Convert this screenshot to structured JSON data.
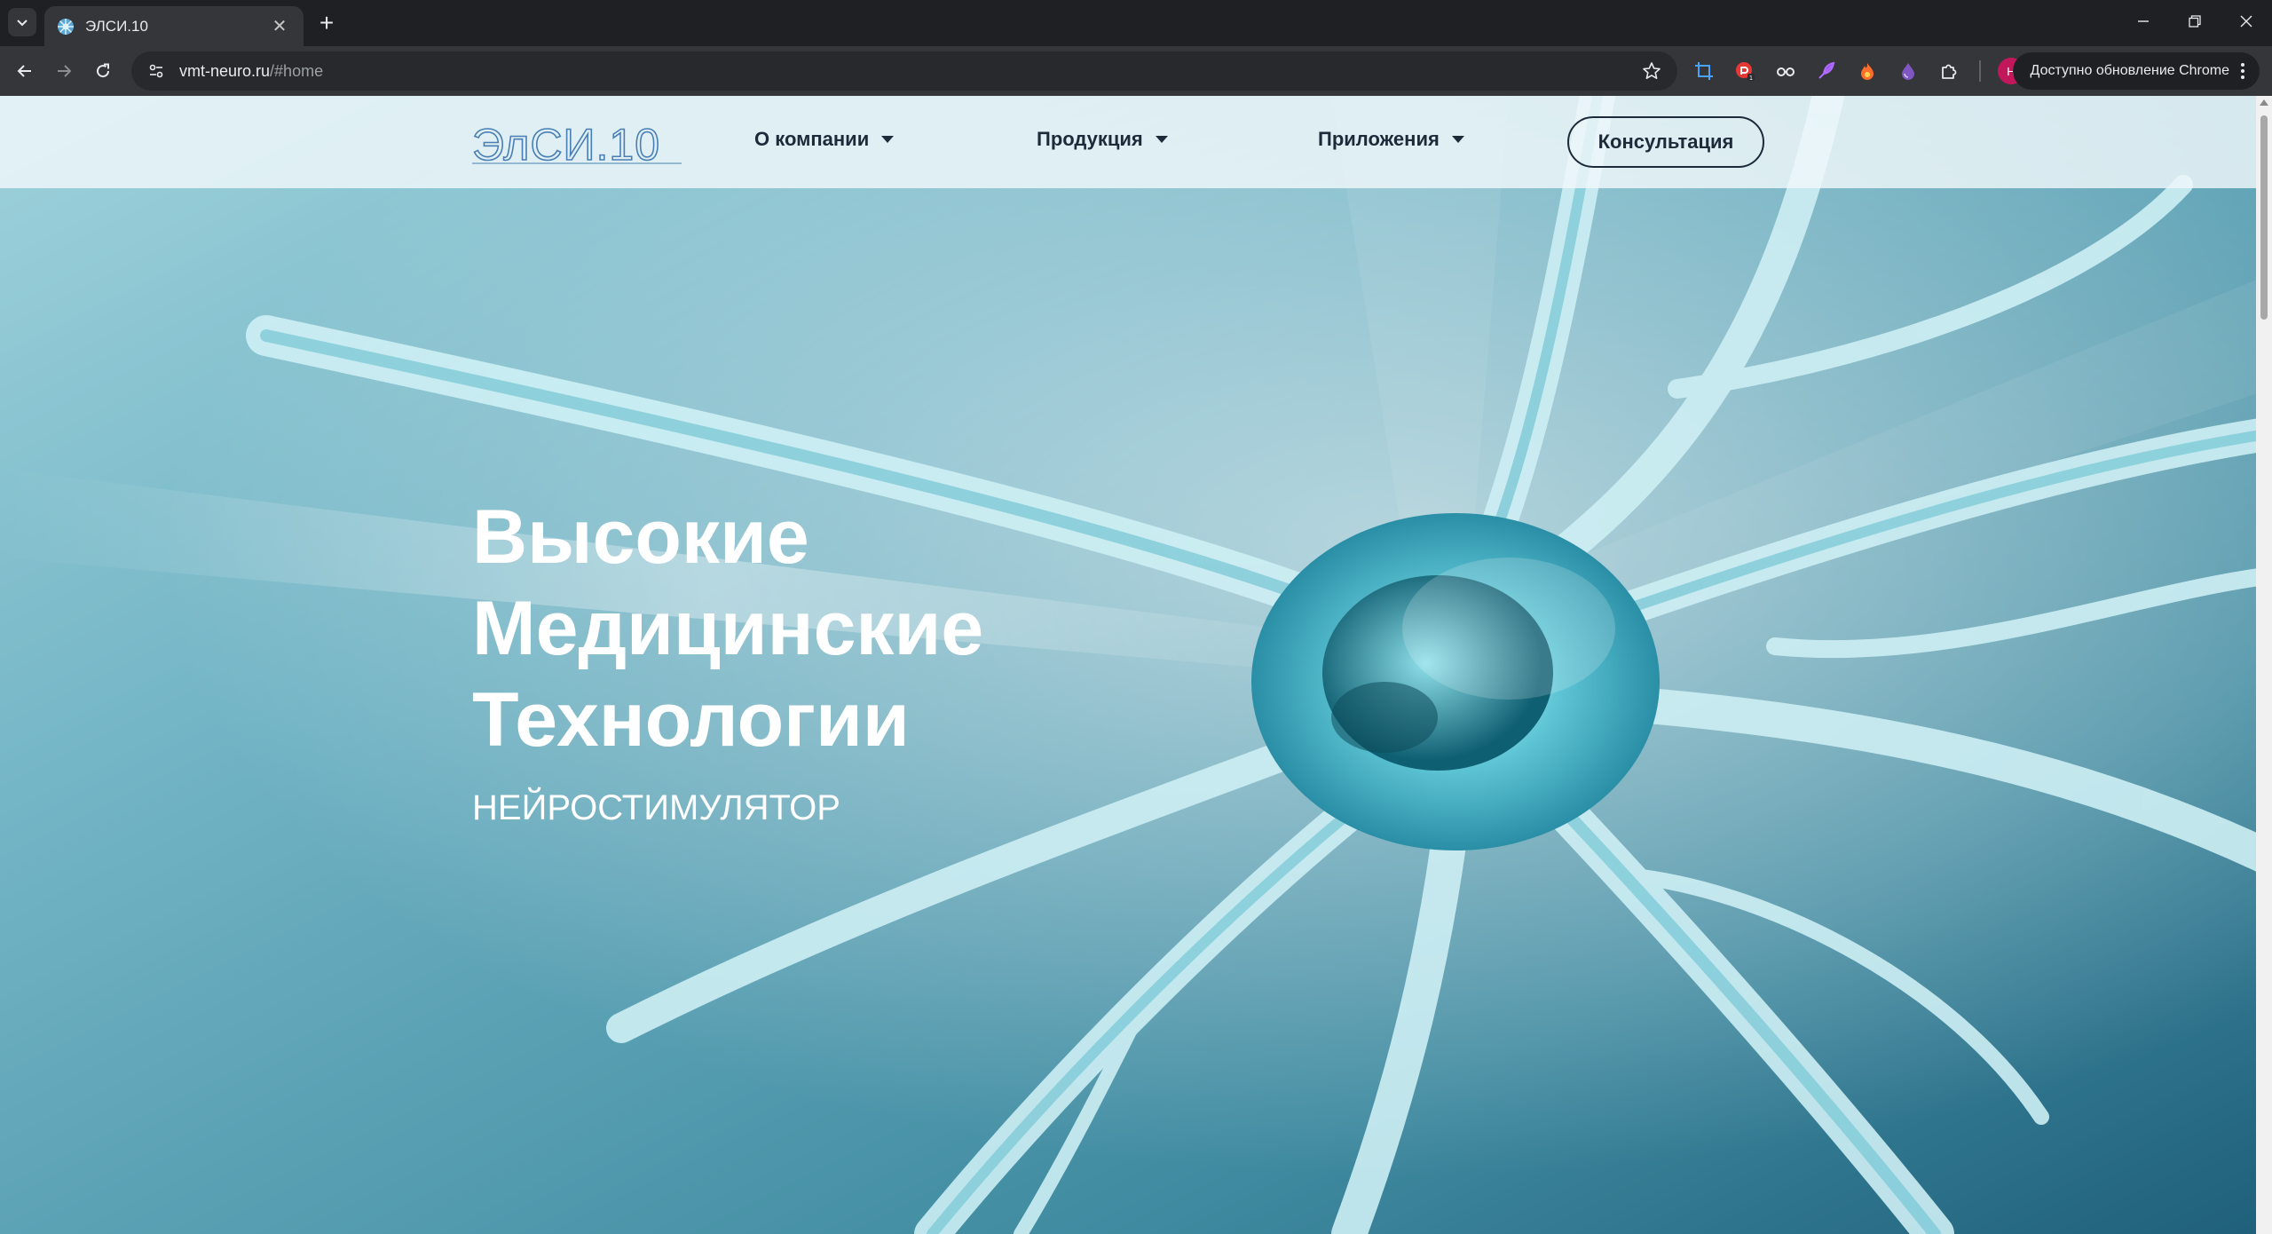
{
  "browser": {
    "tab_title": "ЭЛСИ.10",
    "url_host": "vmt-neuro.ru",
    "url_path": "/#home",
    "profile_initial": "Н",
    "update_label": "Доступно обновление Chrome"
  },
  "site": {
    "logo_text": "ЭлСИ.10",
    "nav": {
      "about": "О компании",
      "products": "Продукция",
      "apps": "Приложения",
      "consult": "Консультация"
    },
    "hero": {
      "line1": "Высокие",
      "line2": "Медицинские",
      "line3": "Технологии",
      "subtitle": "НЕЙРОСТИМУЛЯТОР"
    }
  },
  "colors": {
    "brand_dark": "#1c2a3a",
    "logo_blue": "#4a7fb5",
    "hero_teal": "#4c96a8"
  }
}
